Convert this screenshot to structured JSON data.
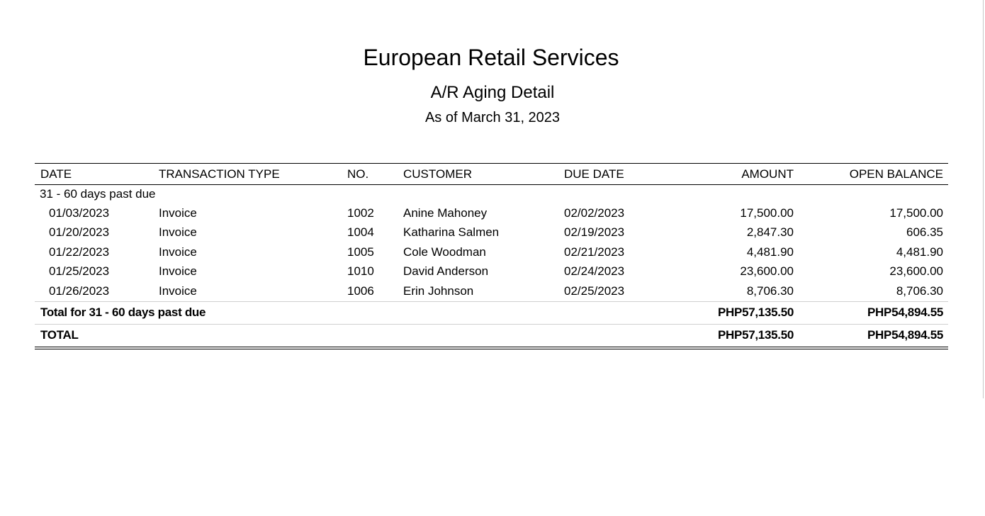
{
  "company": "European Retail Services",
  "report_title": "A/R Aging Detail",
  "report_date": "As of March 31, 2023",
  "columns": {
    "date": "DATE",
    "transaction_type": "TRANSACTION TYPE",
    "no": "NO.",
    "customer": "CUSTOMER",
    "due_date": "DUE DATE",
    "amount": "AMOUNT",
    "open_balance": "OPEN BALANCE"
  },
  "group": {
    "label": "31 - 60 days past due",
    "rows": [
      {
        "date": "01/03/2023",
        "type": "Invoice",
        "no": "1002",
        "customer": "Anine Mahoney",
        "due_date": "02/02/2023",
        "amount": "17,500.00",
        "open_balance": "17,500.00"
      },
      {
        "date": "01/20/2023",
        "type": "Invoice",
        "no": "1004",
        "customer": "Katharina Salmen",
        "due_date": "02/19/2023",
        "amount": "2,847.30",
        "open_balance": "606.35"
      },
      {
        "date": "01/22/2023",
        "type": "Invoice",
        "no": "1005",
        "customer": "Cole Woodman",
        "due_date": "02/21/2023",
        "amount": "4,481.90",
        "open_balance": "4,481.90"
      },
      {
        "date": "01/25/2023",
        "type": "Invoice",
        "no": "1010",
        "customer": "David Anderson",
        "due_date": "02/24/2023",
        "amount": "23,600.00",
        "open_balance": "23,600.00"
      },
      {
        "date": "01/26/2023",
        "type": "Invoice",
        "no": "1006",
        "customer": "Erin Johnson",
        "due_date": "02/25/2023",
        "amount": "8,706.30",
        "open_balance": "8,706.30"
      }
    ],
    "total_label": "Total for 31 - 60 days past due",
    "total_amount": "PHP57,135.50",
    "total_open_balance": "PHP54,894.55"
  },
  "grand_total": {
    "label": "TOTAL",
    "amount": "PHP57,135.50",
    "open_balance": "PHP54,894.55"
  }
}
